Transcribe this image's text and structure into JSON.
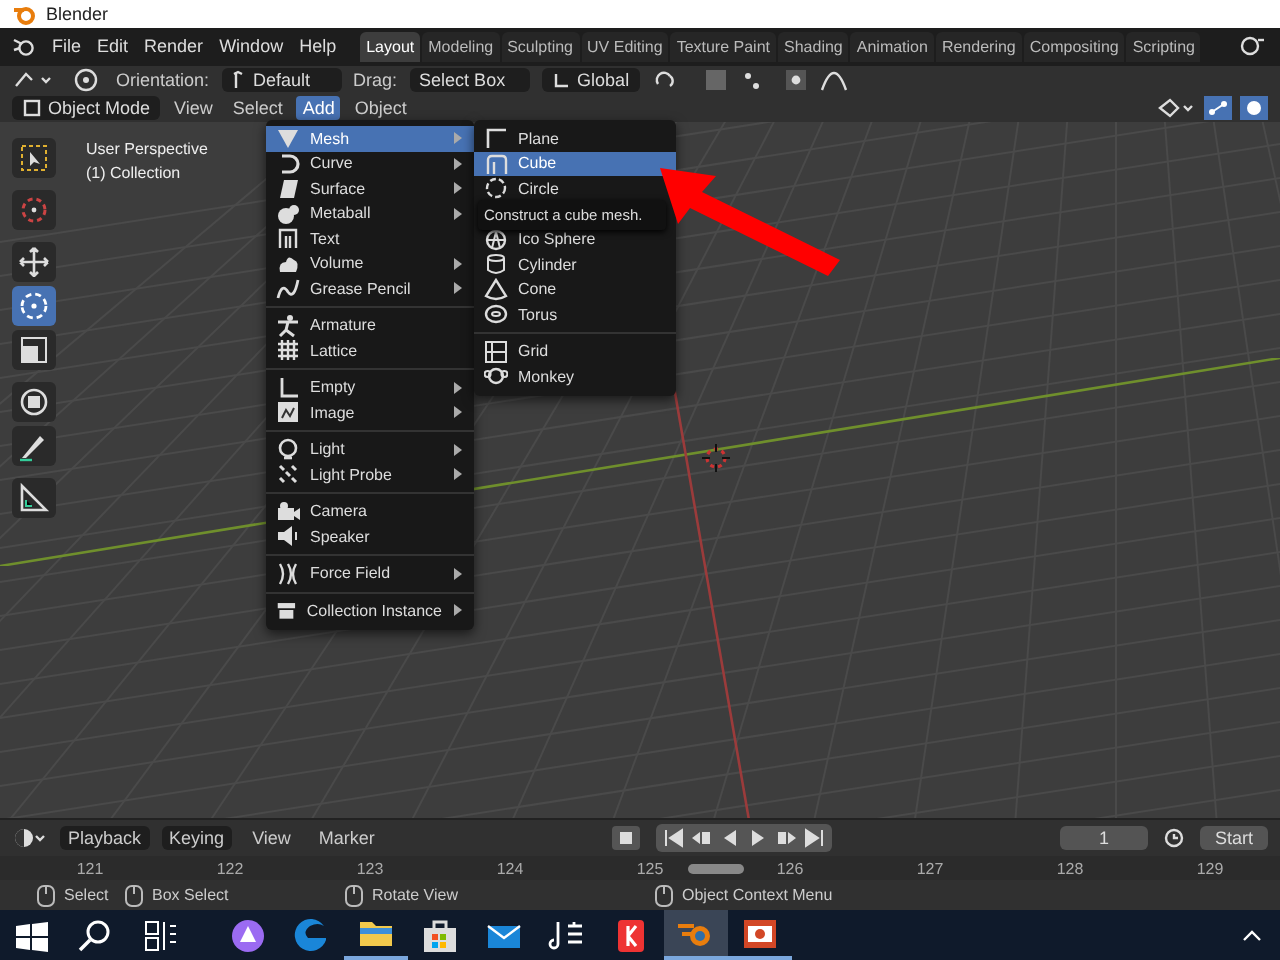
{
  "window": {
    "title": "Blender"
  },
  "menu_bar": {
    "items": [
      "File",
      "Edit",
      "Render",
      "Window",
      "Help"
    ]
  },
  "workspace_tabs": [
    {
      "label": "Layout",
      "selected": true
    },
    {
      "label": "Modeling",
      "selected": false
    },
    {
      "label": "Sculpting",
      "selected": false
    },
    {
      "label": "UV Editing",
      "selected": false
    },
    {
      "label": "Texture Paint",
      "selected": false
    },
    {
      "label": "Shading",
      "selected": false
    },
    {
      "label": "Animation",
      "selected": false
    },
    {
      "label": "Rendering",
      "selected": false
    },
    {
      "label": "Compositing",
      "selected": false
    },
    {
      "label": "Scripting",
      "selected": false
    }
  ],
  "tool_header": {
    "orientation_label": "Orientation:",
    "orientation": "Default",
    "drag_label": "Drag:",
    "drag": "Select Box",
    "transform_orientation": "Global"
  },
  "viewport_header": {
    "mode": "Object Mode",
    "menus": [
      {
        "label": "View",
        "selected": false
      },
      {
        "label": "Select",
        "selected": false
      },
      {
        "label": "Add",
        "selected": true
      },
      {
        "label": "Object",
        "selected": false
      }
    ]
  },
  "viewport": {
    "overlay_text": [
      "User Perspective",
      "(1) Collection"
    ],
    "tools": [
      {
        "kind": "select",
        "selected": false
      },
      {
        "kind": "cursor",
        "selected": false
      },
      {
        "kind": "move",
        "selected": false
      },
      {
        "kind": "rotate",
        "selected": true
      },
      {
        "kind": "scale",
        "selected": false
      },
      {
        "kind": "transform",
        "selected": false
      },
      {
        "kind": "annotate",
        "selected": false
      },
      {
        "kind": "measure",
        "selected": false
      }
    ]
  },
  "add_menu": {
    "sections": [
      [
        {
          "label": "Mesh",
          "kind": "mesh",
          "has_submenu": true,
          "selected": true
        },
        {
          "label": "Curve",
          "kind": "curve",
          "has_submenu": true,
          "selected": false
        },
        {
          "label": "Surface",
          "kind": "surface",
          "has_submenu": true,
          "selected": false
        },
        {
          "label": "Metaball",
          "kind": "metaball",
          "has_submenu": true,
          "selected": false
        },
        {
          "label": "Text",
          "kind": "text",
          "has_submenu": false,
          "selected": false
        },
        {
          "label": "Volume",
          "kind": "volume",
          "has_submenu": true,
          "selected": false
        },
        {
          "label": "Grease Pencil",
          "kind": "pencil",
          "has_submenu": true,
          "selected": false
        }
      ],
      [
        {
          "label": "Armature",
          "kind": "armature",
          "has_submenu": false,
          "selected": false
        },
        {
          "label": "Lattice",
          "kind": "lattice",
          "has_submenu": false,
          "selected": false
        }
      ],
      [
        {
          "label": "Empty",
          "kind": "empty",
          "has_submenu": true,
          "selected": false
        },
        {
          "label": "Image",
          "kind": "image",
          "has_submenu": true,
          "selected": false
        }
      ],
      [
        {
          "label": "Light",
          "kind": "light",
          "has_submenu": true,
          "selected": false
        },
        {
          "label": "Light Probe",
          "kind": "probe",
          "has_submenu": true,
          "selected": false
        }
      ],
      [
        {
          "label": "Camera",
          "kind": "camera",
          "has_submenu": false,
          "selected": false
        },
        {
          "label": "Speaker",
          "kind": "speaker",
          "has_submenu": false,
          "selected": false
        }
      ],
      [
        {
          "label": "Force Field",
          "kind": "field",
          "has_submenu": true,
          "selected": false
        }
      ],
      [
        {
          "label": "Collection Instance",
          "kind": "collection",
          "has_submenu": true,
          "selected": false
        }
      ]
    ]
  },
  "mesh_submenu": {
    "sections": [
      [
        {
          "label": "Plane",
          "kind": "plane",
          "selected": false
        },
        {
          "label": "Cube",
          "kind": "cube",
          "selected": true
        },
        {
          "label": "Circle",
          "kind": "circle",
          "selected": false
        },
        {
          "kind": "hidden"
        },
        {
          "label": "Ico Sphere",
          "kind": "sphere",
          "selected": false
        },
        {
          "label": "Cylinder",
          "kind": "cylinder",
          "selected": false
        },
        {
          "label": "Cone",
          "kind": "cone",
          "selected": false
        },
        {
          "label": "Torus",
          "kind": "torus",
          "selected": false
        }
      ],
      [
        {
          "label": "Grid",
          "kind": "grid",
          "selected": false
        },
        {
          "label": "Monkey",
          "kind": "monkey",
          "selected": false
        }
      ]
    ],
    "tooltip": "Construct a cube mesh."
  },
  "timeline": {
    "menus": [
      "Playback",
      "Keying",
      "View",
      "Marker"
    ],
    "current_frame": "1",
    "start_label": "Start",
    "ruler": [
      "121",
      "122",
      "123",
      "124",
      "125",
      "126",
      "127",
      "128",
      "129"
    ]
  },
  "status_bar": [
    "Select",
    "Box Select",
    "Rotate View",
    "Object Context Menu"
  ],
  "taskbar": [
    {
      "kind": "start",
      "open": false
    },
    {
      "kind": "search",
      "open": false
    },
    {
      "kind": "taskview",
      "open": false
    },
    {
      "kind": "assistant",
      "open": false
    },
    {
      "kind": "edge",
      "open": false
    },
    {
      "kind": "explorer",
      "open": true
    },
    {
      "kind": "store",
      "open": false
    },
    {
      "kind": "mail",
      "open": false
    },
    {
      "kind": "music",
      "open": false
    },
    {
      "kind": "yandex",
      "open": false
    },
    {
      "kind": "blender",
      "open": true,
      "active": true
    },
    {
      "kind": "powerpoint",
      "open": true
    }
  ]
}
